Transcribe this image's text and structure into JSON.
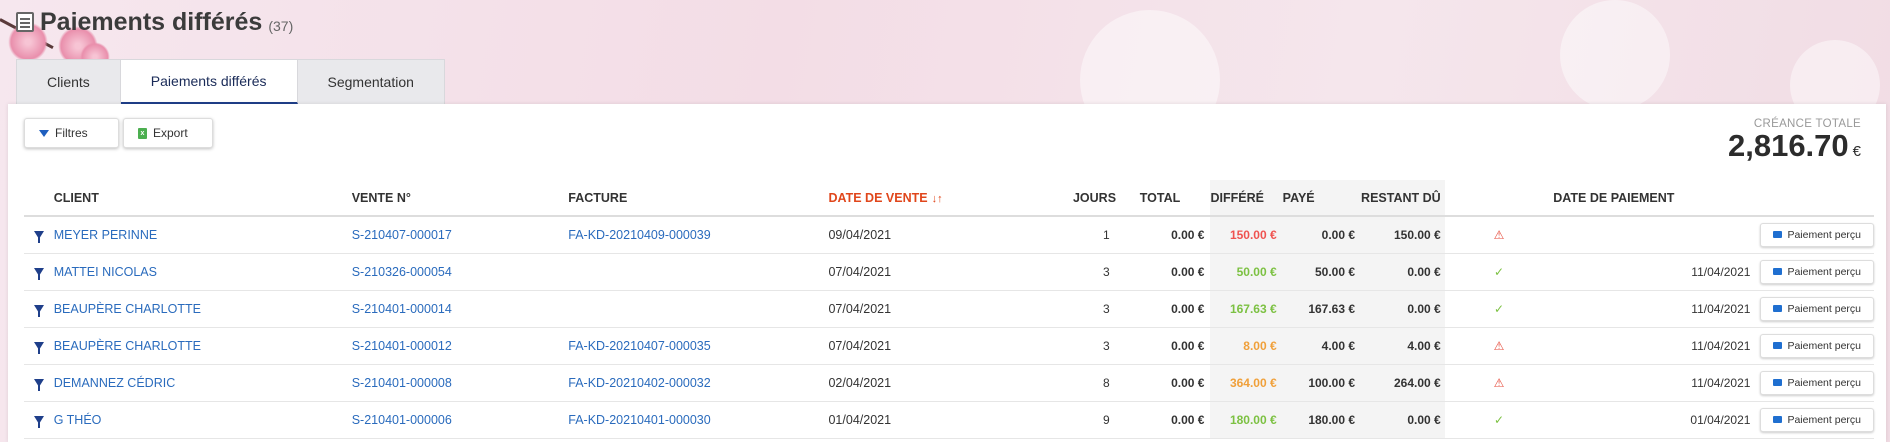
{
  "header": {
    "title": "Paiements différés",
    "count": "(37)",
    "icon": "invoice-icon"
  },
  "tabs": [
    {
      "label": "Clients",
      "active": false
    },
    {
      "label": "Paiements différés",
      "active": true
    },
    {
      "label": "Segmentation",
      "active": false
    }
  ],
  "toolbar": {
    "filters_label": "Filtres",
    "export_label": "Export",
    "filters_icon": "filter-icon",
    "export_icon": "excel-icon"
  },
  "total": {
    "label": "CRÉANCE TOTALE",
    "value": "2,816.70",
    "currency": "€"
  },
  "columns": {
    "client": "CLIENT",
    "vente": "VENTE N°",
    "facture": "FACTURE",
    "date_vente": "DATE DE VENTE",
    "jours": "JOURS",
    "total": "TOTAL",
    "differe": "DIFFÉRÉ",
    "paye": "PAYÉ",
    "restant": "RESTANT DÛ",
    "date_paiement": "DATE DE PAIEMENT"
  },
  "sort_icon": "↓↑",
  "pay_label": "Paiement perçu",
  "colors": {
    "accent": "#1f3f8a",
    "link": "#2a6bbd",
    "sort": "#e0461b",
    "red": "#ef5350",
    "green": "#7cc142",
    "orange": "#f0a03a"
  },
  "rows": [
    {
      "client": "MEYER PERINNE",
      "vente": "S-210407-000017",
      "facture": "FA-KD-20210409-000039",
      "date_vente": "09/04/2021",
      "jours": "1",
      "total": "0.00 €",
      "differe": "150.00 €",
      "differe_color": "red",
      "paye": "0.00 €",
      "restant": "150.00 €",
      "status": "warning",
      "status_glyph": "⚠",
      "date_paiement": ""
    },
    {
      "client": "MATTEI NICOLAS",
      "vente": "S-210326-000054",
      "facture": "",
      "date_vente": "07/04/2021",
      "jours": "3",
      "total": "0.00 €",
      "differe": "50.00 €",
      "differe_color": "green",
      "paye": "50.00 €",
      "restant": "0.00 €",
      "status": "ok",
      "status_glyph": "✓",
      "date_paiement": "11/04/2021"
    },
    {
      "client": "BEAUPÈRE CHARLOTTE",
      "vente": "S-210401-000014",
      "facture": "",
      "date_vente": "07/04/2021",
      "jours": "3",
      "total": "0.00 €",
      "differe": "167.63 €",
      "differe_color": "green",
      "paye": "167.63 €",
      "restant": "0.00 €",
      "status": "ok",
      "status_glyph": "✓",
      "date_paiement": "11/04/2021"
    },
    {
      "client": "BEAUPÈRE CHARLOTTE",
      "vente": "S-210401-000012",
      "facture": "FA-KD-20210407-000035",
      "date_vente": "07/04/2021",
      "jours": "3",
      "total": "0.00 €",
      "differe": "8.00 €",
      "differe_color": "orange",
      "paye": "4.00 €",
      "restant": "4.00 €",
      "status": "warning",
      "status_glyph": "⚠",
      "date_paiement": "11/04/2021"
    },
    {
      "client": "DEMANNEZ CÉDRIC",
      "vente": "S-210401-000008",
      "facture": "FA-KD-20210402-000032",
      "date_vente": "02/04/2021",
      "jours": "8",
      "total": "0.00 €",
      "differe": "364.00 €",
      "differe_color": "orange",
      "paye": "100.00 €",
      "restant": "264.00 €",
      "status": "warning",
      "status_glyph": "⚠",
      "date_paiement": "11/04/2021"
    },
    {
      "client": "G THÉO",
      "vente": "S-210401-000006",
      "facture": "FA-KD-20210401-000030",
      "date_vente": "01/04/2021",
      "jours": "9",
      "total": "0.00 €",
      "differe": "180.00 €",
      "differe_color": "green",
      "paye": "180.00 €",
      "restant": "0.00 €",
      "status": "ok",
      "status_glyph": "✓",
      "date_paiement": "01/04/2021"
    }
  ]
}
